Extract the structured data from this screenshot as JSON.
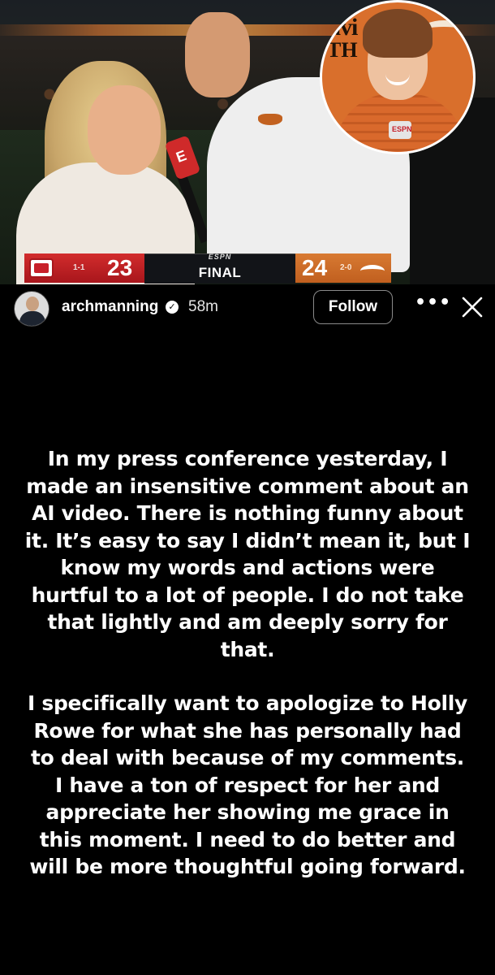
{
  "photo": {
    "inset_sign_line1": "avi",
    "inset_sign_line2": "TH",
    "inset_mic_label": "ESPN"
  },
  "scoreboard": {
    "away_record": "1-1",
    "away_score": "23",
    "network": "ESPN",
    "status": "FINAL",
    "home_score": "24",
    "home_record": "2-0"
  },
  "header": {
    "username": "archmanning",
    "verified_icon": "verified-badge-icon",
    "time_ago": "58m",
    "follow_label": "Follow",
    "more_icon": "more-options-icon",
    "close_icon": "close-icon"
  },
  "caption": {
    "paragraph1": "In my press conference yesterday, I made an insensitive comment about an AI video. There is nothing funny about it. It’s easy to say I didn’t mean it, but I know my words and actions were hurtful to a lot of people. I do not take that lightly and am deeply sorry for that.",
    "paragraph2": "I specifically want to apologize to Holly Rowe for what she has personally had to deal with because of my comments. I have a ton of respect for her and appreciate her showing me grace in this moment. I need to do better and will be more thoughtful going forward."
  },
  "colors": {
    "background": "#000000",
    "texas_orange": "#cc6a26",
    "ohio_red": "#bb1f24"
  }
}
